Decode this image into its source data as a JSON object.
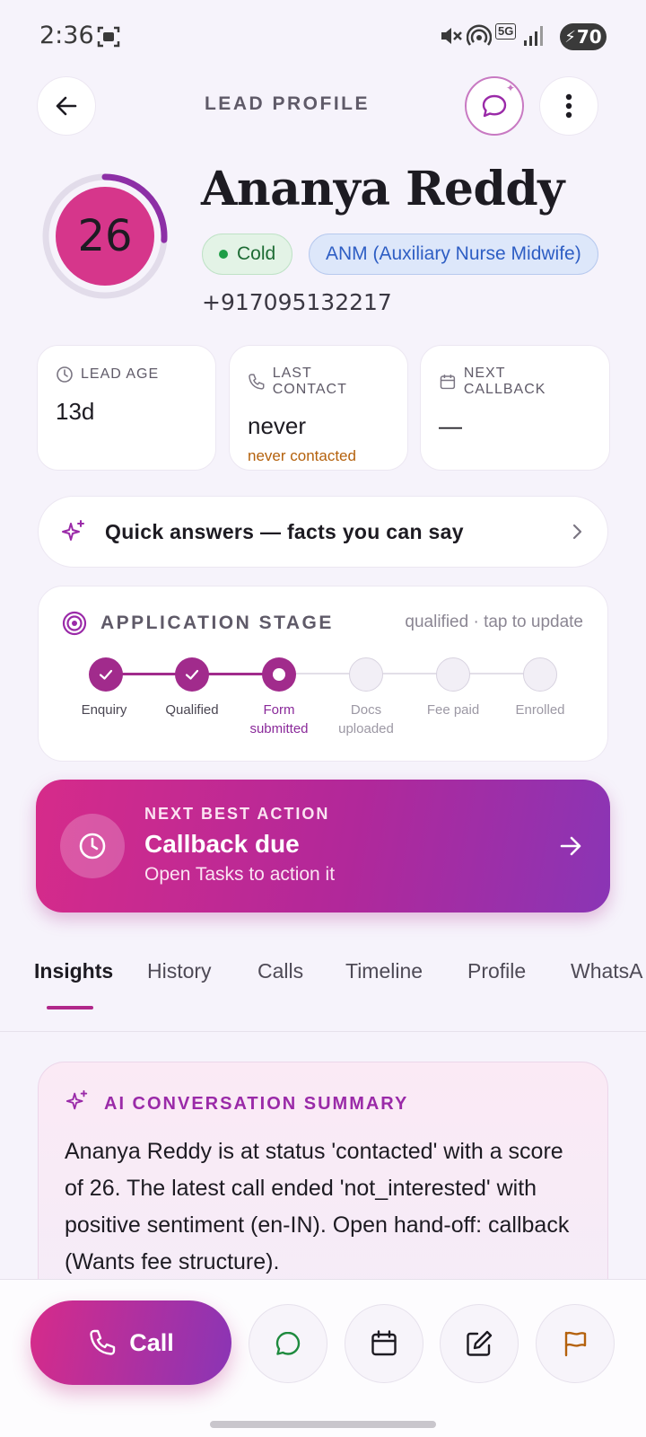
{
  "status_bar": {
    "time": "2:36",
    "battery": "70",
    "network": "5G"
  },
  "header": {
    "title": "LEAD PROFILE"
  },
  "lead": {
    "score": "26",
    "name": "Ananya Reddy",
    "temperature": "Cold",
    "course": "ANM (Auxiliary Nurse Midwife)",
    "phone": "+917095132217",
    "score_fraction": 0.26
  },
  "stats": [
    {
      "label": "LEAD AGE",
      "value": "13d",
      "sub": ""
    },
    {
      "label": "LAST CONTACT",
      "value": "never",
      "sub": "never contacted"
    },
    {
      "label": "NEXT CALLBACK",
      "value": "—",
      "sub": ""
    }
  ],
  "quick_answers": {
    "label": "Quick answers — facts you can say"
  },
  "stage": {
    "title": "APPLICATION STAGE",
    "status": "qualified · tap to update",
    "steps": [
      {
        "line1": "Enquiry",
        "line2": "",
        "state": "done"
      },
      {
        "line1": "Qualified",
        "line2": "",
        "state": "done"
      },
      {
        "line1": "Form",
        "line2": "submitted",
        "state": "current"
      },
      {
        "line1": "Docs",
        "line2": "uploaded",
        "state": "todo"
      },
      {
        "line1": "Fee paid",
        "line2": "",
        "state": "todo"
      },
      {
        "line1": "Enrolled",
        "line2": "",
        "state": "todo"
      }
    ]
  },
  "next_best_action": {
    "kicker": "NEXT BEST ACTION",
    "title": "Callback due",
    "subtitle": "Open Tasks to action it"
  },
  "tabs": [
    "Insights",
    "History",
    "Calls",
    "Timeline",
    "Profile",
    "WhatsA"
  ],
  "ai_summary": {
    "title": "AI CONVERSATION SUMMARY",
    "body": "Ananya Reddy is at status 'contacted' with a score of 26. The latest call ended 'not_interested' with positive sentiment (en-IN). Open hand-off: callback (Wants fee structure)."
  },
  "bottom_bar": {
    "call_label": "Call"
  },
  "colors": {
    "accent": "#b0278a",
    "cold_green": "#1f9e47",
    "course_blue": "#2e5ec4",
    "warning_orange": "#b4610c"
  }
}
